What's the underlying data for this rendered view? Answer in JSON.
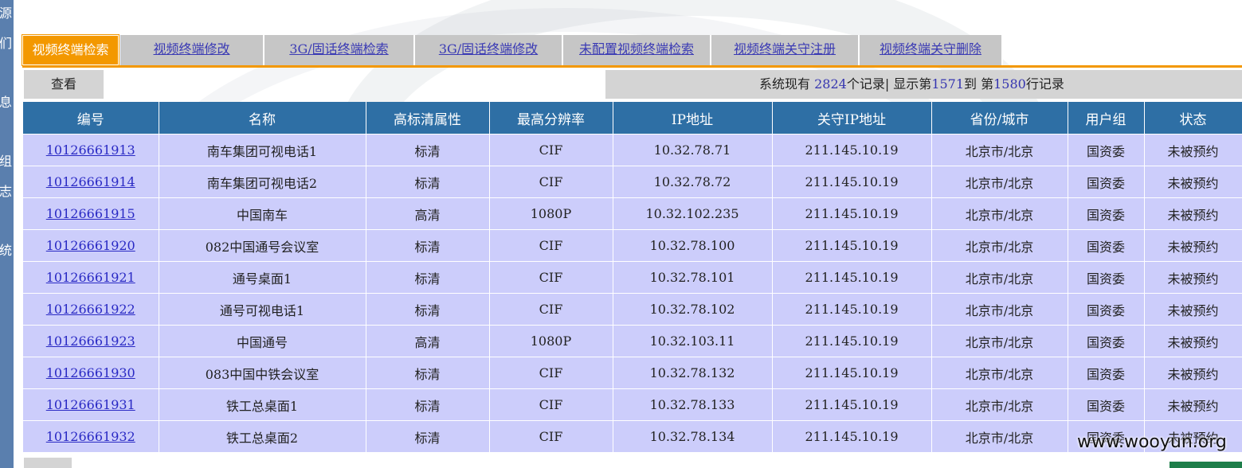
{
  "sidebar": {
    "chars": [
      "源",
      "们",
      "息",
      "组",
      "志",
      "统"
    ]
  },
  "tabs": [
    {
      "label": "视频终端检索",
      "active": true
    },
    {
      "label": "视频终端修改",
      "active": false
    },
    {
      "label": "3G/固话终端检索",
      "active": false
    },
    {
      "label": "3G/固话终端修改",
      "active": false
    },
    {
      "label": "未配置视频终端检索",
      "active": false
    },
    {
      "label": "视频终端关守注册",
      "active": false
    },
    {
      "label": "视频终端关守删除",
      "active": false
    }
  ],
  "toolbar": {
    "view_label": "查看",
    "info": {
      "prefix": "系统现有",
      "total": "2824",
      "middle": "个记录|  显示第",
      "from": "1571",
      "to_label": "到  第",
      "to": "1580",
      "suffix": "行记录"
    }
  },
  "table": {
    "headers": [
      "编号",
      "名称",
      "高标清属性",
      "最高分辨率",
      "IP地址",
      "关守IP地址",
      "省份/城市",
      "用户组",
      "状态"
    ],
    "rows": [
      {
        "id": "10126661913",
        "name": "南车集团可视电话1",
        "quality": "标清",
        "resolution": "CIF",
        "ip": "10.32.78.71",
        "gk_ip": "211.145.10.19",
        "region": "北京市/北京",
        "group": "国资委",
        "status": "未被预约"
      },
      {
        "id": "10126661914",
        "name": "南车集团可视电话2",
        "quality": "标清",
        "resolution": "CIF",
        "ip": "10.32.78.72",
        "gk_ip": "211.145.10.19",
        "region": "北京市/北京",
        "group": "国资委",
        "status": "未被预约"
      },
      {
        "id": "10126661915",
        "name": "中国南车",
        "quality": "高清",
        "resolution": "1080P",
        "ip": "10.32.102.235",
        "gk_ip": "211.145.10.19",
        "region": "北京市/北京",
        "group": "国资委",
        "status": "未被预约"
      },
      {
        "id": "10126661920",
        "name": "082中国通号会议室",
        "quality": "标清",
        "resolution": "CIF",
        "ip": "10.32.78.100",
        "gk_ip": "211.145.10.19",
        "region": "北京市/北京",
        "group": "国资委",
        "status": "未被预约"
      },
      {
        "id": "10126661921",
        "name": "通号桌面1",
        "quality": "标清",
        "resolution": "CIF",
        "ip": "10.32.78.101",
        "gk_ip": "211.145.10.19",
        "region": "北京市/北京",
        "group": "国资委",
        "status": "未被预约"
      },
      {
        "id": "10126661922",
        "name": "通号可视电话1",
        "quality": "标清",
        "resolution": "CIF",
        "ip": "10.32.78.102",
        "gk_ip": "211.145.10.19",
        "region": "北京市/北京",
        "group": "国资委",
        "status": "未被预约"
      },
      {
        "id": "10126661923",
        "name": "中国通号",
        "quality": "高清",
        "resolution": "1080P",
        "ip": "10.32.103.11",
        "gk_ip": "211.145.10.19",
        "region": "北京市/北京",
        "group": "国资委",
        "status": "未被预约"
      },
      {
        "id": "10126661930",
        "name": "083中国中铁会议室",
        "quality": "标清",
        "resolution": "CIF",
        "ip": "10.32.78.132",
        "gk_ip": "211.145.10.19",
        "region": "北京市/北京",
        "group": "国资委",
        "status": "未被预约"
      },
      {
        "id": "10126661931",
        "name": "铁工总桌面1",
        "quality": "标清",
        "resolution": "CIF",
        "ip": "10.32.78.133",
        "gk_ip": "211.145.10.19",
        "region": "北京市/北京",
        "group": "国资委",
        "status": "未被预约"
      },
      {
        "id": "10126661932",
        "name": "铁工总桌面2",
        "quality": "标清",
        "resolution": "CIF",
        "ip": "10.32.78.134",
        "gk_ip": "211.145.10.19",
        "region": "北京市/北京",
        "group": "国资委",
        "status": "未被预约"
      }
    ]
  },
  "watermark": "www.wooyun.org",
  "colors": {
    "tab_active": "#f39800",
    "tab_inactive": "#c6c6c6",
    "header_bg": "#2e6fa5",
    "row_bg": "#cccdfb",
    "link": "#2929c4",
    "sidebar": "#5a7fae"
  }
}
